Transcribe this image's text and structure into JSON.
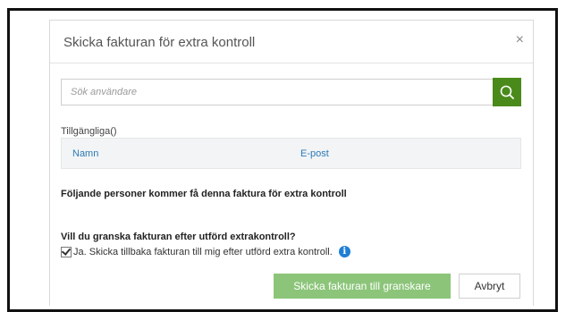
{
  "dialog": {
    "title": "Skicka fakturan för extra kontroll",
    "close_label": "×"
  },
  "search": {
    "placeholder": "Sök användare",
    "icon": "search-icon"
  },
  "available": {
    "label": "Tillgängliga()",
    "columns": [
      "Namn",
      "E-post"
    ]
  },
  "recipients_text": "Följande personer kommer få denna faktura för extra kontroll",
  "review": {
    "question": "Vill du granska fakturan efter utförd extrakontroll?",
    "checkbox_label": "Ja. Skicka tillbaka fakturan till mig efter utförd extra kontroll.",
    "checked": true,
    "info_glyph": "i"
  },
  "actions": {
    "submit_label": "Skicka fakturan till granskare",
    "cancel_label": "Avbryt"
  },
  "colors": {
    "accent_green": "#4a8a1a",
    "submit_green": "#8cc57a",
    "link_blue": "#2d7ab8",
    "info_blue": "#1f7fd6"
  }
}
